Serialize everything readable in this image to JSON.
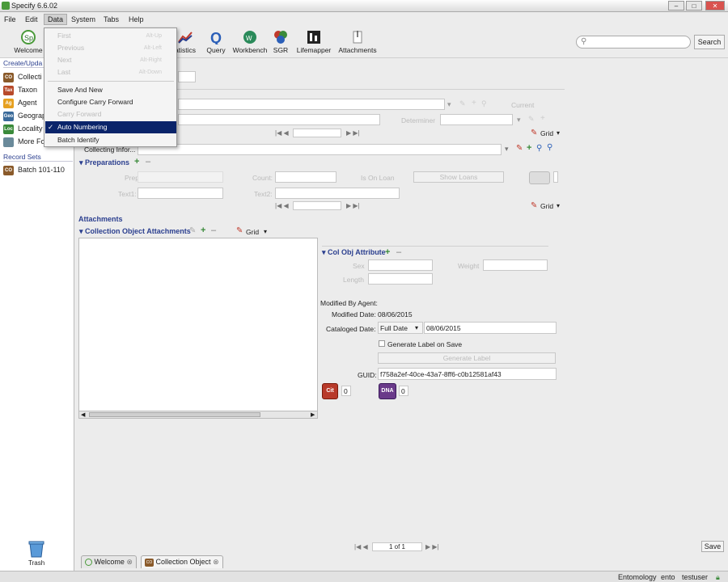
{
  "window": {
    "title": "Specify 6.6.02"
  },
  "menu": {
    "items": [
      "File",
      "Edit",
      "Data",
      "System",
      "Tabs",
      "Help"
    ]
  },
  "toolbar": {
    "welcome": "Welcome",
    "statistics": "atistics",
    "query": "Query",
    "workbench": "Workbench",
    "sgr": "SGR",
    "lifemapper": "Lifemapper",
    "attachments": "Attachments"
  },
  "search": {
    "button": "Search"
  },
  "data_menu": {
    "first": "First",
    "first_acc": "Alt-Up",
    "previous": "Previous",
    "previous_acc": "Alt-Left",
    "next": "Next",
    "next_acc": "Alt-Right",
    "last": "Last",
    "last_acc": "Alt-Down",
    "save_and_new": "Save And New",
    "configure_carry_forward": "Configure Carry Forward",
    "carry_forward": "Carry Forward",
    "auto_numbering": "Auto Numbering",
    "batch_identify": "Batch Identify"
  },
  "sidebar": {
    "create_header": "Create/Upda",
    "items": [
      {
        "label": "Collecti",
        "abbr": "CO",
        "color": "#8a5a2a"
      },
      {
        "label": "Taxon",
        "abbr": "Tax",
        "color": "#b84a2a"
      },
      {
        "label": "Agent",
        "abbr": "Ag",
        "color": "#e6a020"
      },
      {
        "label": "Geograp",
        "abbr": "Geo",
        "color": "#3a6a9a"
      },
      {
        "label": "Locality",
        "abbr": "Loc",
        "color": "#3a8a3a"
      },
      {
        "label": "More Fo",
        "abbr": "",
        "color": "#6a8a9a"
      }
    ],
    "record_sets_header": "Record Sets",
    "record_sets": [
      {
        "label": "Batch 101-110",
        "abbr": "CO",
        "color": "#8a5a2a"
      }
    ]
  },
  "form": {
    "current_label": "Current",
    "determiner_label": "Determiner",
    "grid_label": "Grid",
    "collecting_info_label": "Collecting Infor...",
    "preparations_section": "Preparations",
    "prep_type_label": "Prep Type:",
    "count_label": "Count:",
    "is_on_loan_label": "Is On Loan",
    "show_loans_button": "Show Loans",
    "text1_label": "Text1:",
    "text2_label": "Text2:",
    "attachments_section": "Attachments",
    "co_attachments_section": "Collection Object Attachments",
    "col_obj_attribute_section": "Col Obj Attribute",
    "sex_label": "Sex",
    "weight_label": "Weight",
    "length_label": "Length",
    "modified_by_agent_label": "Modified By Agent:",
    "modified_date_label": "Modified Date:",
    "modified_date_value": "08/06/2015",
    "cataloged_date_label": "Cataloged Date:",
    "cataloged_date_type": "Full Date",
    "cataloged_date_value": "08/06/2015",
    "generate_label_on_save": "Generate Label on Save",
    "generate_label_button": "Generate Label",
    "guid_label": "GUID:",
    "guid_value": "f758a2ef-40ce-43a7-8ff6-c0b12581af43",
    "cit_count": "0",
    "dna_count": "0",
    "record_nav": "1 of 1",
    "save_button": "Save"
  },
  "tabs": [
    {
      "label": "Welcome"
    },
    {
      "label": "Collection Object"
    }
  ],
  "trash": {
    "label": "Trash"
  },
  "status": {
    "discipline": "Entomology",
    "collection": "ento",
    "user": "testuser"
  }
}
